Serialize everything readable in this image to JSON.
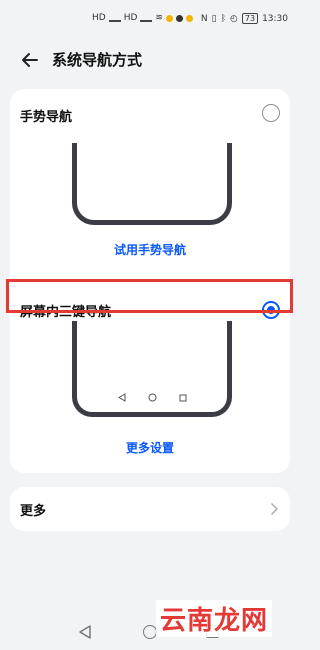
{
  "status_bar": {
    "time": "13:30",
    "battery": "73",
    "signal_labels": [
      "HD",
      "HD"
    ]
  },
  "header": {
    "title": "系统导航方式",
    "back_icon": "arrow-left-icon"
  },
  "navigation_options": [
    {
      "label": "手势导航",
      "selected": false,
      "action_link": "试用手势导航"
    },
    {
      "label": "屏幕内三键导航",
      "selected": true,
      "action_link": "更多设置"
    }
  ],
  "more_section": {
    "label": "更多",
    "icon": "chevron-right-icon"
  },
  "watermark": "云南龙网",
  "colors": {
    "accent": "#0a59f7",
    "highlight": "#e53935",
    "phone_frame": "#3c3c46",
    "background": "#f1f3f5"
  }
}
